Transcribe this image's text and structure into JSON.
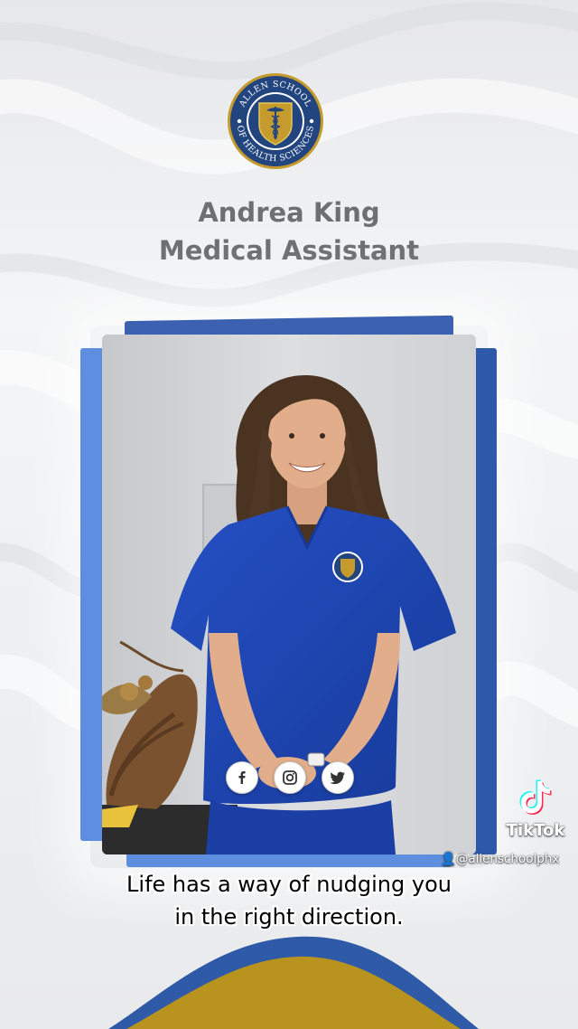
{
  "school": {
    "seal_top_text": "ALLEN SCHOOL",
    "seal_bottom_text": "OF HEALTH SCIENCES",
    "seal_colors": {
      "ring": "#22457f",
      "shield": "#c49b2c",
      "accent": "#e4c65c"
    }
  },
  "profile": {
    "name": "Andrea King",
    "role": "Medical Assistant"
  },
  "social": {
    "icons": [
      "facebook-icon",
      "instagram-icon",
      "twitter-icon"
    ]
  },
  "tiktok": {
    "label": "TikTok",
    "handle": "@allenschoolphx"
  },
  "caption": {
    "line1": "Life has a way of nudging you",
    "line2": "in the right direction."
  },
  "colors": {
    "frame_dark": "#2e58aa",
    "frame_light": "#5e8ee0",
    "scrubs": "#1f48b8",
    "wave_blue": "#2f5aa8",
    "wave_gold": "#b8941f",
    "title_gray": "#6d7073"
  }
}
